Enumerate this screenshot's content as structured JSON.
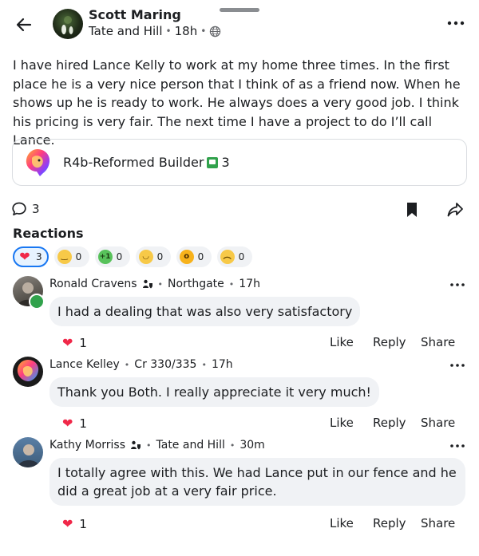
{
  "header": {
    "author": "Scott Maring",
    "location": "Tate and Hill",
    "time": "18h"
  },
  "post": {
    "text": "I have hired Lance Kelly to work at my home three times. In the first place he is a very nice person that I think of as a friend now. When he shows up he is ready to work. He always does a very good job. I think his pricing is very fair. The next time I have a project to do I’ll call Lance."
  },
  "tag": {
    "label": "R4b-Reformed Builder",
    "count": "3"
  },
  "actions": {
    "comment_count": "3"
  },
  "reactions": {
    "title": "Reactions",
    "items": [
      {
        "icon": "heart-icon",
        "count": "3",
        "selected": true
      },
      {
        "icon": "smile-icon",
        "count": "0"
      },
      {
        "icon": "plus-one-icon",
        "label": "+1",
        "count": "0"
      },
      {
        "icon": "grin-icon",
        "count": "0"
      },
      {
        "icon": "wow-icon",
        "count": "0"
      },
      {
        "icon": "sad-icon",
        "count": "0"
      }
    ]
  },
  "comments": [
    {
      "name": "Ronald Cravens",
      "location": "Northgate",
      "time": "17h",
      "text": "I had a dealing that was also very satisfactory",
      "likes": "1",
      "like_label": "Like",
      "reply_label": "Reply",
      "share_label": "Share"
    },
    {
      "name": "Lance Kelley",
      "location": "Cr 330/335",
      "time": "17h",
      "text": "Thank you Both.  I really appreciate it very much!",
      "likes": "1",
      "like_label": "Like",
      "reply_label": "Reply",
      "share_label": "Share"
    },
    {
      "name": "Kathy Morriss",
      "location": "Tate and Hill",
      "time": "30m",
      "text": "I totally agree with this. We had Lance put in our fence and he did a great job at a very fair price.",
      "likes": "1",
      "like_label": "Like",
      "reply_label": "Reply",
      "share_label": "Share"
    }
  ],
  "colors": {
    "accent": "#1877f2",
    "heart": "#f02849",
    "bubble": "#f0f2f5"
  }
}
